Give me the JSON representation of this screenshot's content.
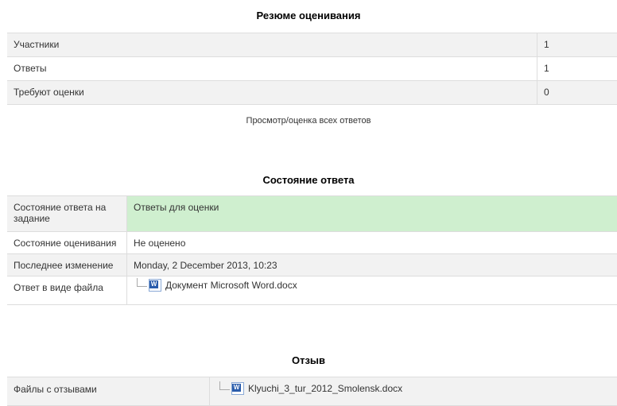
{
  "grading_summary": {
    "heading": "Резюме оценивания",
    "rows": [
      {
        "label": "Участники",
        "value": "1"
      },
      {
        "label": "Ответы",
        "value": "1"
      },
      {
        "label": "Требуют оценки",
        "value": "0"
      }
    ],
    "view_all_link": "Просмотр/оценка всех ответов"
  },
  "submission_status": {
    "heading": "Состояние ответа",
    "rows": [
      {
        "label": "Состояние ответа на задание",
        "value": "Ответы для оценки"
      },
      {
        "label": "Состояние оценивания",
        "value": "Не оценено"
      },
      {
        "label": "Последнее изменение",
        "value": "Monday, 2 December 2013, 10:23"
      },
      {
        "label": "Ответ в виде файла",
        "value": "Документ Microsoft Word.docx",
        "icon": "word-file-icon"
      }
    ]
  },
  "feedback": {
    "heading": "Отзыв",
    "rows": [
      {
        "label": "Файлы с отзывами",
        "value": "Klyuchi_3_tur_2012_Smolensk.docx",
        "icon": "word-file-icon"
      }
    ]
  },
  "colors": {
    "status_highlight": "#cfefcf",
    "row_alt": "#f2f2f2",
    "border": "#dddddd"
  }
}
